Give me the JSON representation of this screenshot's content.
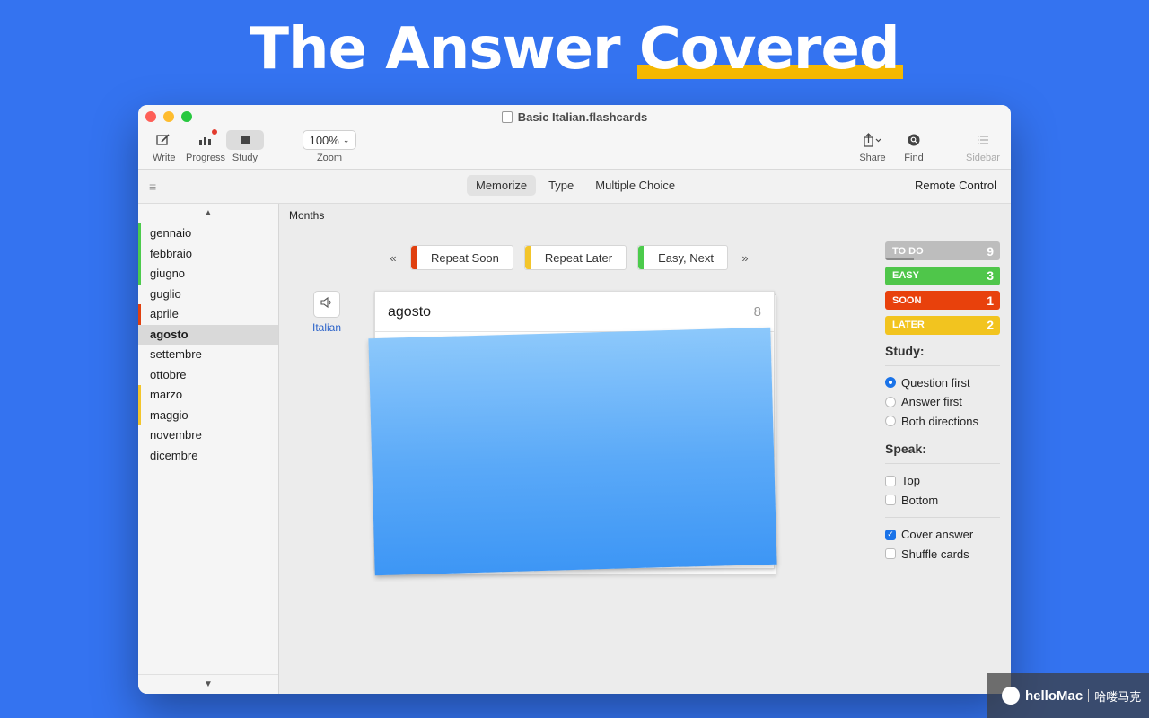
{
  "headline": {
    "prefix": "The Answer",
    "highlight": "Covered"
  },
  "window": {
    "title": "Basic Italian.flashcards"
  },
  "toolbar": {
    "write": "Write",
    "progress": "Progress",
    "study": "Study",
    "zoom_value": "100%",
    "zoom_label": "Zoom",
    "share": "Share",
    "find": "Find",
    "sidebar": "Sidebar"
  },
  "modebar": {
    "modes": [
      "Memorize",
      "Type",
      "Multiple Choice"
    ],
    "active_mode": "Memorize",
    "remote": "Remote Control"
  },
  "sidebar": {
    "items": [
      {
        "label": "gennaio",
        "status": "easy"
      },
      {
        "label": "febbraio",
        "status": "easy"
      },
      {
        "label": "giugno",
        "status": "easy"
      },
      {
        "label": "guglio",
        "status": ""
      },
      {
        "label": "aprile",
        "status": "soon"
      },
      {
        "label": "agosto",
        "status": "",
        "selected": true
      },
      {
        "label": "settembre",
        "status": ""
      },
      {
        "label": "ottobre",
        "status": ""
      },
      {
        "label": "marzo",
        "status": "later"
      },
      {
        "label": "maggio",
        "status": "later"
      },
      {
        "label": "novembre",
        "status": ""
      },
      {
        "label": "dicembre",
        "status": ""
      }
    ]
  },
  "main": {
    "section_title": "Months",
    "prev": "«",
    "next": "»",
    "buttons": [
      {
        "label": "Repeat Soon",
        "color": "#e0400f"
      },
      {
        "label": "Repeat Later",
        "color": "#f3c52b"
      },
      {
        "label": "Easy, Next",
        "color": "#4ccb4c"
      }
    ],
    "language": "Italian",
    "card": {
      "question": "agosto",
      "number": "8"
    }
  },
  "stats": [
    {
      "name": "TO DO",
      "count": "9",
      "color": "#bdbdbd",
      "fill_color": "#8a8a8a",
      "progress": 0.25
    },
    {
      "name": "EASY",
      "count": "3",
      "color": "#4fc64a"
    },
    {
      "name": "SOON",
      "count": "1",
      "color": "#e8410c"
    },
    {
      "name": "LATER",
      "count": "2",
      "color": "#f2c41f"
    }
  ],
  "study": {
    "heading": "Study:",
    "options": [
      "Question first",
      "Answer first",
      "Both directions"
    ],
    "selected": "Question first"
  },
  "speak": {
    "heading": "Speak:",
    "options": [
      {
        "label": "Top",
        "checked": false
      },
      {
        "label": "Bottom",
        "checked": false
      }
    ]
  },
  "extra_options": [
    {
      "label": "Cover answer",
      "checked": true
    },
    {
      "label": "Shuffle cards",
      "checked": false
    }
  ],
  "status_colors": {
    "easy": "#4ccb4c",
    "soon": "#e0400f",
    "later": "#f3c52b"
  },
  "watermark": {
    "brand": "helloMac",
    "cn": "哈喽马克"
  }
}
